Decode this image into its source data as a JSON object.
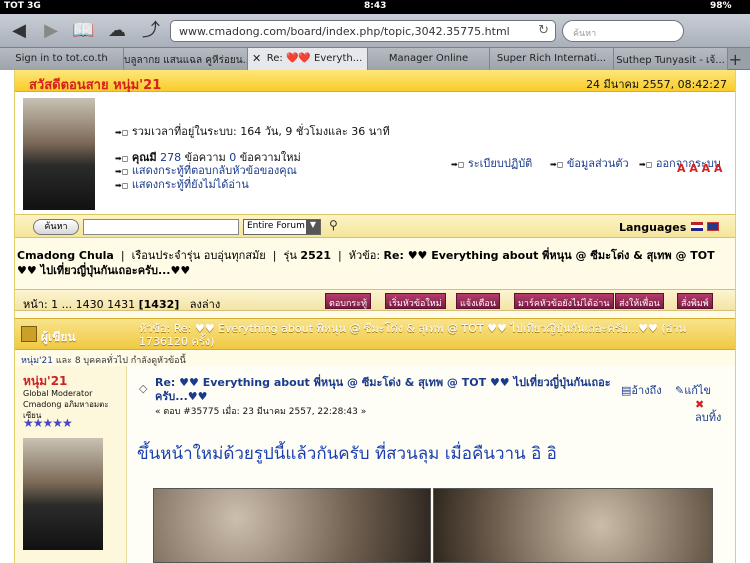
{
  "status": {
    "carrier": "TOT 3G",
    "network": "3G",
    "time": "8:43",
    "battery": "98%"
  },
  "browser": {
    "url": "www.cmadong.com/board/index.php/topic,3042.35775.html",
    "search_placeholder": "ค้นหา",
    "tabs": [
      {
        "label": "Sign in to tot.co.th"
      },
      {
        "label": "บลูลากย แสนแฉล คูหีร่อยน..."
      },
      {
        "label": "Re: ❤️❤️ Everyth..."
      },
      {
        "label": "Manager Online"
      },
      {
        "label": "Super Rich Internati..."
      },
      {
        "label": "Suthep Tunyasit - เจ้..."
      }
    ]
  },
  "header": {
    "greeting": "สวัสดีตอนสาย",
    "username": "หนุ่ม'21",
    "datetime": "24 มีนาคม 2557, 08:42:27"
  },
  "user": {
    "online_time": "รวมเวลาที่อยู่ในระบบ: 164 วัน, 9 ชั่วโมงและ 36 นาที",
    "messages_prefix": "คุณมี",
    "messages_count": "278",
    "messages_label": "ข้อความ",
    "new_count": "0",
    "new_label": "ข้อความใหม่",
    "link_replies": "แสดงกระทู้ที่ตอบกลับหัวข้อของคุณ",
    "link_unread": "แสดงกระทู้ที่ยังไม่ได้อ่าน",
    "link_calendar": "ระเบียบปฏิบัติ",
    "link_profile": "ข้อมูลส่วนตัว",
    "link_logout": "ออกจากระบบ",
    "font_sizes": "A A A A"
  },
  "search": {
    "button": "ค้นหา",
    "scope": "Entire Forum",
    "languages": "Languages"
  },
  "breadcrumb": {
    "site": "Cmadong Chula",
    "board": "เรือนประจำรุ่น อบอุ่นทุกสมัย",
    "sep": "|",
    "class_label": "รุ่น",
    "class_value": "2521",
    "topic_label": "หัวข้อ:",
    "topic_value": "Re: ♥♥ Everything about พี่หนุน @ ซีมะโด่ง & สุเทพ @ TOT ♥♥ ไปเที่ยวญี่ปุ่นกันเถอะครับ...♥♥"
  },
  "pager": {
    "label": "หน้า: 1 ... 1430 1431",
    "current": "[1432]",
    "down": "ลงล่าง",
    "buttons": [
      "ตอบกระทู้",
      "เริ่มหัวข้อใหม่",
      "แจ้งเตือน",
      "มาร์คหัวข้อยังไม่ได้อ่าน",
      "ส่งให้เพื่อน",
      "สั่งพิมพ์"
    ]
  },
  "postheader": {
    "author_col": "ผู้เขียน",
    "topic_col": "หัวข้อ: Re: ♥♥ Everything about พี่หนุน @ ซีมะโด่ง & สุเทพ @ TOT ♥♥ ไปเที่ยวญี่ปุ่นกันเถอะครับ...♥♥ (อ่าน 1736120 ครั้ง)"
  },
  "viewers": {
    "name": "หนุ่ม'21",
    "rest": "และ 8 บุคคลทั่วไป กำลังดูหัวข้อนี้"
  },
  "poster": {
    "name": "หนุ่ม'21",
    "role": "Global Moderator",
    "group": "Cmadong อภิมหาอมตะเซียน",
    "stars": "★★★★★"
  },
  "post": {
    "title": "Re: ♥♥ Everything about พี่หนุน @ ซีมะโด่ง & สุเทพ @ TOT ♥♥ ไปเที่ยวญี่ปุ่นกันเถอะครับ...♥♥",
    "meta": "« ตอบ #35775 เมื่อ: 23 มีนาคม 2557, 22:28:43 »",
    "quote": "อ้างถึง",
    "edit": "แก้ไข",
    "delete": "ลบทิ้ง",
    "body": "ขึ้นหน้าใหม่ด้วยรูปนี้แล้วกันครับ ที่สวนลุม เมื่อคืนวาน อิ อิ"
  }
}
